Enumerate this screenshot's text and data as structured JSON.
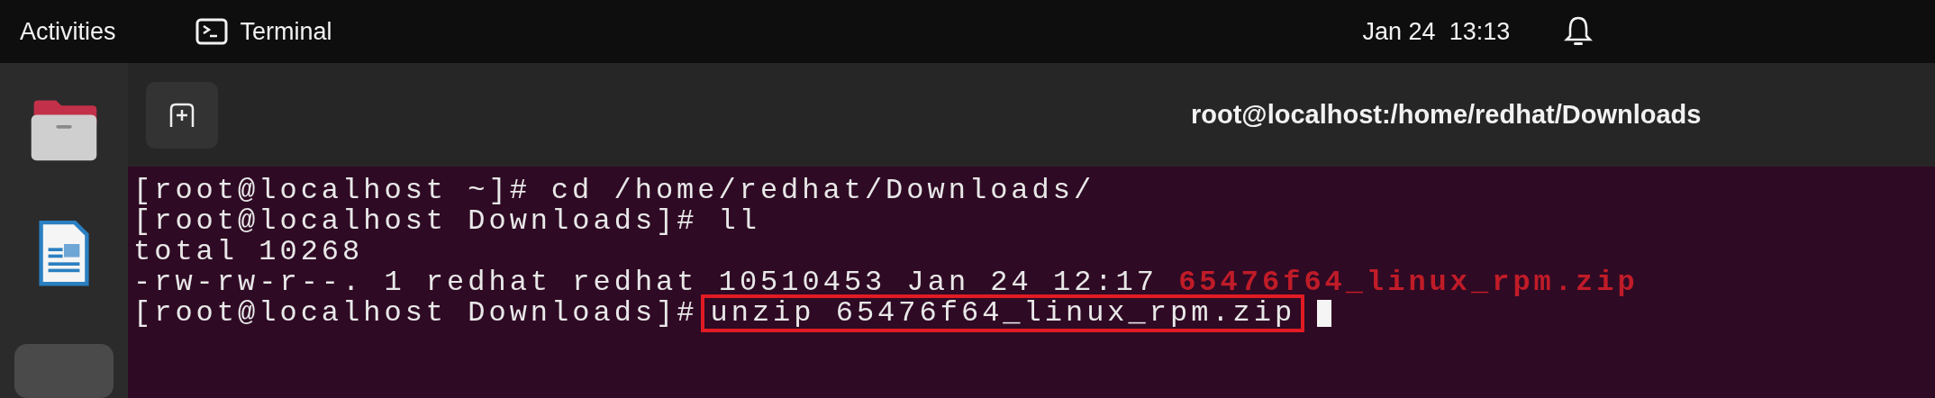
{
  "top_bar": {
    "activities": "Activities",
    "app_name": "Terminal",
    "clock": "Jan 24  13:13"
  },
  "terminal": {
    "title": "root@localhost:/home/redhat/Downloads",
    "lines": [
      {
        "kind": "prompt",
        "prompt": "[root@localhost ~]#",
        "command": "cd /home/redhat/Downloads/",
        "highlighted": false,
        "cursor": false
      },
      {
        "kind": "prompt",
        "prompt": "[root@localhost Downloads]#",
        "command": "ll",
        "highlighted": false,
        "cursor": false
      },
      {
        "kind": "output",
        "text": "total 10268"
      },
      {
        "kind": "listing",
        "text": "-rw-rw-r--. 1 redhat redhat 10510453 Jan 24 12:17",
        "filename": "65476f64_linux_rpm.zip",
        "color": "#c01c28"
      },
      {
        "kind": "prompt",
        "prompt": "[root@localhost Downloads]#",
        "command": "unzip 65476f64_linux_rpm.zip",
        "highlighted": true,
        "cursor": true
      }
    ]
  }
}
